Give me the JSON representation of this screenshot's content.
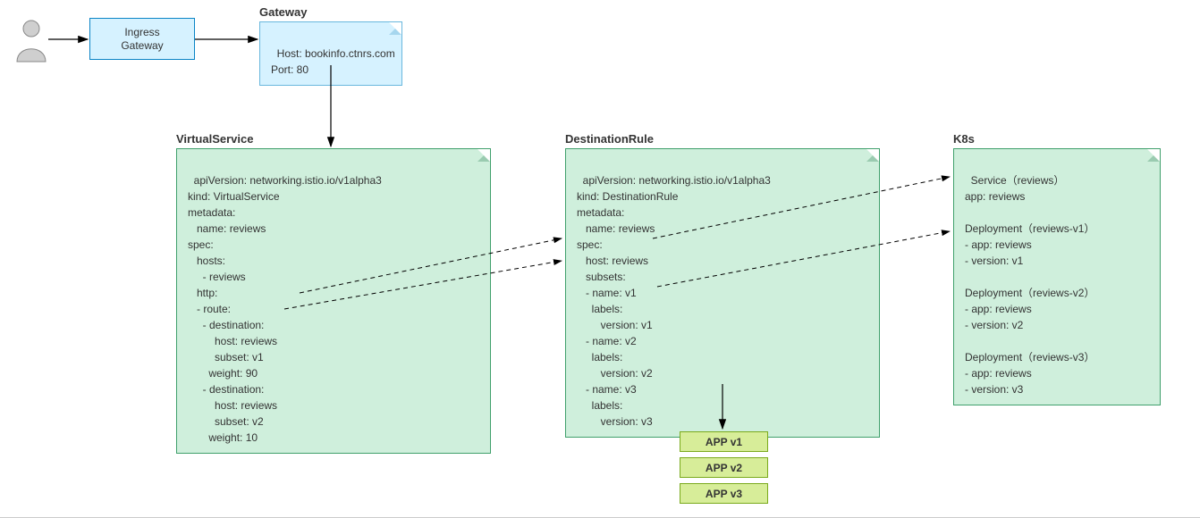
{
  "ingress": {
    "label": "Ingress\nGateway"
  },
  "gateway": {
    "title": "Gateway",
    "body": "Host: bookinfo.ctnrs.com\nPort: 80"
  },
  "virtualservice": {
    "title": "VirtualService",
    "body": "apiVersion: networking.istio.io/v1alpha3\nkind: VirtualService\nmetadata:\n   name: reviews\nspec:\n   hosts:\n     - reviews\n   http:\n   - route:\n     - destination:\n         host: reviews\n         subset: v1\n       weight: 90\n     - destination:\n         host: reviews\n         subset: v2\n       weight: 10"
  },
  "destinationrule": {
    "title": "DestinationRule",
    "body": "apiVersion: networking.istio.io/v1alpha3\nkind: DestinationRule\nmetadata:\n   name: reviews\nspec:\n   host: reviews\n   subsets:\n   - name: v1\n     labels:\n        version: v1\n   - name: v2\n     labels:\n        version: v2\n   - name: v3\n     labels:\n        version: v3"
  },
  "k8s": {
    "title": "K8s",
    "body": "Service（reviews）\napp: reviews\n\nDeployment（reviews-v1）\n- app: reviews\n- version: v1\n\nDeployment（reviews-v2）\n- app: reviews\n- version: v2\n\nDeployment（reviews-v3）\n- app: reviews\n- version: v3"
  },
  "apps": {
    "v1": "APP v1",
    "v2": "APP v2",
    "v3": "APP v3"
  }
}
